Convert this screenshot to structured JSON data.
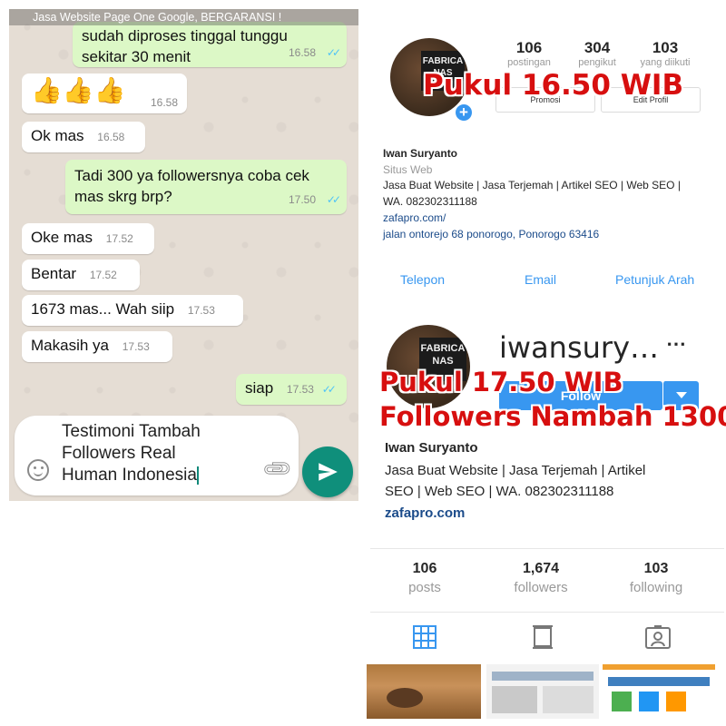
{
  "whatsapp": {
    "status_bar": "Jasa Website Page One Google, BERGARANSI !",
    "messages": [
      {
        "text": "sudah diproses tinggal tunggu sekitar 30 menit",
        "time": "16.58",
        "side": "out"
      },
      {
        "text": "👍👍👍",
        "time": "16.58",
        "side": "in"
      },
      {
        "text": "Ok mas",
        "time": "16.58",
        "side": "in"
      },
      {
        "text": "Tadi 300 ya followersnya coba cek mas skrg brp?",
        "time": "17.50",
        "side": "out"
      },
      {
        "text": "Oke mas",
        "time": "17.52",
        "side": "in"
      },
      {
        "text": "Bentar",
        "time": "17.52",
        "side": "in"
      },
      {
        "text": "1673 mas... Wah siip",
        "time": "17.53",
        "side": "in"
      },
      {
        "text": "Makasih ya",
        "time": "17.53",
        "side": "in"
      },
      {
        "text": "siap",
        "time": "17.53",
        "side": "out"
      }
    ],
    "input_value": "Testimoni Tambah\nFollowers Real\nHuman Indonesia",
    "icons": {
      "emoji": "emoji-icon",
      "attach": "paperclip-icon",
      "send": "send-icon"
    }
  },
  "instagram_before": {
    "avatar_text": "FABRICA NAS",
    "stats": [
      {
        "value": "106",
        "label": "postingan"
      },
      {
        "value": "304",
        "label": "pengikut"
      },
      {
        "value": "103",
        "label": "yang diikuti"
      }
    ],
    "buttons": [
      "Promosi",
      "Edit Profil"
    ],
    "overlay": "Pukul 16.50 WIB",
    "name": "Iwan Suryanto",
    "category": "Situs Web",
    "bio_line1": "Jasa Buat Website | Jasa Terjemah | Artikel SEO | Web SEO |",
    "bio_line2": "WA. 082302311188",
    "link": "zafapro.com/",
    "address": "jalan ontorejo 68 ponorogo, Ponorogo 63416",
    "actions": [
      "Telepon",
      "Email",
      "Petunjuk Arah"
    ]
  },
  "instagram_after": {
    "avatar_text": "FABRICA NAS",
    "username": "iwansury…",
    "more_icon": "⋯",
    "follow_label": "Follow",
    "overlay_line1": "Pukul 17.50 WIB",
    "overlay_line2": "Followers Nambah 1300",
    "name": "Iwan Suryanto",
    "bio_line1": "Jasa Buat Website | Jasa Terjemah | Artikel",
    "bio_line2": "SEO | Web SEO | WA. 082302311188",
    "link": "zafapro.com",
    "counts": [
      {
        "value": "106",
        "label": "posts"
      },
      {
        "value": "1,674",
        "label": "followers"
      },
      {
        "value": "103",
        "label": "following"
      }
    ],
    "tabs": [
      "grid-icon",
      "feed-icon",
      "tagged-icon"
    ]
  },
  "colors": {
    "wa_green": "#0f8f7b",
    "wa_out": "#dcf8c6",
    "ig_blue": "#3897f0",
    "overlay_red": "#d70f0f"
  }
}
